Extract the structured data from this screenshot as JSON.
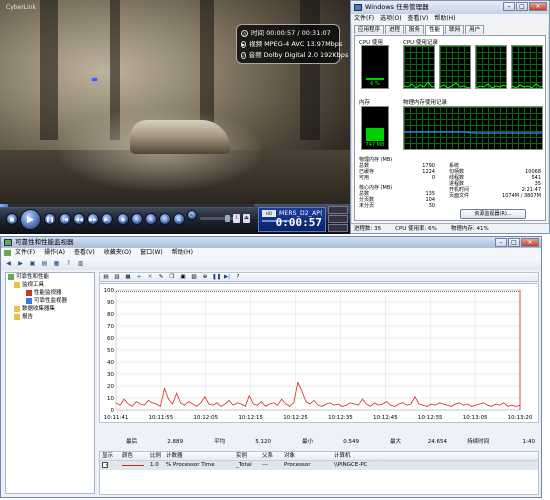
{
  "player": {
    "logo": "CyberLink",
    "osd": {
      "time_label": "时间",
      "time_value": "00:00:57 / 00:31:07",
      "video_label": "视频",
      "video_value": "MPEG-4 AVC 13.97Mbps",
      "audio_label": "音频",
      "audio_value": "Dolby Digital 2.0  192Kbps"
    },
    "progress": 0.03,
    "lcd_tag": "HD",
    "filename": "MERS_D2_AP(",
    "current_time": "0:00:57",
    "volume": 0.7,
    "side_buttons": [
      "",
      "",
      ""
    ]
  },
  "taskmgr": {
    "title": "Windows 任务管理器",
    "menu": [
      "文件(F)",
      "选项(O)",
      "查看(V)",
      "帮助(H)"
    ],
    "tabs": [
      "应用程序",
      "进程",
      "服务",
      "性能",
      "联网",
      "用户"
    ],
    "active_tab": 3,
    "cpu_usage_label": "CPU 使用",
    "cpu_history_label": "CPU 使用记录",
    "cpu_percent": "6 %",
    "cpu_level": 0.06,
    "mem_label": "内存",
    "mem_history_label": "物理内存使用记录",
    "mem_value": "747 MB",
    "mem_level": 0.38,
    "physical_label": "物理内存 (MB)",
    "physical": [
      [
        "总数",
        "1790"
      ],
      [
        "已缓存",
        "1224"
      ],
      [
        "可用",
        "0"
      ]
    ],
    "kernel_label": "核心内存 (MB)",
    "kernel": [
      [
        "总数",
        "135"
      ],
      [
        "分页数",
        "104"
      ],
      [
        "未分页",
        "30"
      ]
    ],
    "system_label": "系统",
    "system": [
      [
        "句柄数",
        "10068"
      ],
      [
        "线程数",
        "541"
      ],
      [
        "进程数",
        "35"
      ],
      [
        "开机时间",
        "2:21:47"
      ],
      [
        "页面文件",
        "1074M / 3807M"
      ]
    ],
    "resmon_button": "资源监视器(R)...",
    "status": {
      "processes": "进程数: 35",
      "cpu": "CPU 使用率: 6%",
      "memory": "物理内存: 41%"
    }
  },
  "perfmon": {
    "title": "可靠性和性能监视器",
    "menu": [
      "文件(F)",
      "操作(A)",
      "查看(V)",
      "收藏夹(O)",
      "窗口(W)",
      "帮助(H)"
    ],
    "tree": [
      {
        "label": "可靠性和性能",
        "level": 0
      },
      {
        "label": "监视工具",
        "level": 1
      },
      {
        "label": "性能监视器",
        "level": 2
      },
      {
        "label": "可靠性监视器",
        "level": 2
      },
      {
        "label": "数据收集器集",
        "level": 1
      },
      {
        "label": "报告",
        "level": 1
      }
    ],
    "stats": [
      [
        "最后",
        "2.889"
      ],
      [
        "平均",
        "5.120"
      ],
      [
        "最小",
        "0.549"
      ],
      [
        "最大",
        "24.654"
      ],
      [
        "持续时间",
        "1:40"
      ]
    ],
    "legend_headers": [
      "显示",
      "颜色",
      "比例",
      "计数器",
      "实例",
      "父系",
      "对象",
      "计算机"
    ],
    "legend_row": [
      "✓",
      "",
      "1.0",
      "% Processor Time",
      "_Total",
      "---",
      "Processor",
      "\\\\PINGCE-PC"
    ],
    "series_color": "#e0261b"
  },
  "chart_data": {
    "type": "line",
    "title": "",
    "xlabel": "",
    "ylabel": "",
    "ylim": [
      0,
      100
    ],
    "yticks": [
      0,
      10,
      20,
      30,
      40,
      50,
      60,
      70,
      80,
      90,
      100
    ],
    "xticks": [
      "10:11:41",
      "10:11:55",
      "10:12:05",
      "10:12:15",
      "10:12:25",
      "10:12:35",
      "10:12:45",
      "10:12:55",
      "10:13:05",
      "10:13:20"
    ],
    "series": [
      {
        "name": "% Processor Time",
        "values": [
          6,
          4,
          9,
          5,
          3,
          7,
          5,
          4,
          8,
          6,
          5,
          3,
          18,
          9,
          5,
          14,
          6,
          4,
          7,
          5,
          3,
          6,
          11,
          5,
          4,
          6,
          3,
          5,
          8,
          4,
          6,
          5,
          3,
          12,
          5,
          4,
          7,
          3,
          5,
          6,
          4,
          9,
          5,
          3,
          6,
          23,
          16,
          7,
          5,
          8,
          4,
          3,
          5,
          6,
          4,
          5,
          3,
          4,
          6,
          5,
          4,
          9,
          5,
          3,
          6,
          4,
          5,
          7,
          4,
          3,
          5,
          6,
          4,
          5,
          11,
          5,
          4,
          3,
          5,
          4,
          6,
          5,
          4,
          3,
          5,
          6,
          4,
          5,
          3,
          4,
          5,
          6,
          4,
          3,
          5,
          4,
          6,
          3,
          4,
          3,
          4
        ]
      }
    ]
  }
}
